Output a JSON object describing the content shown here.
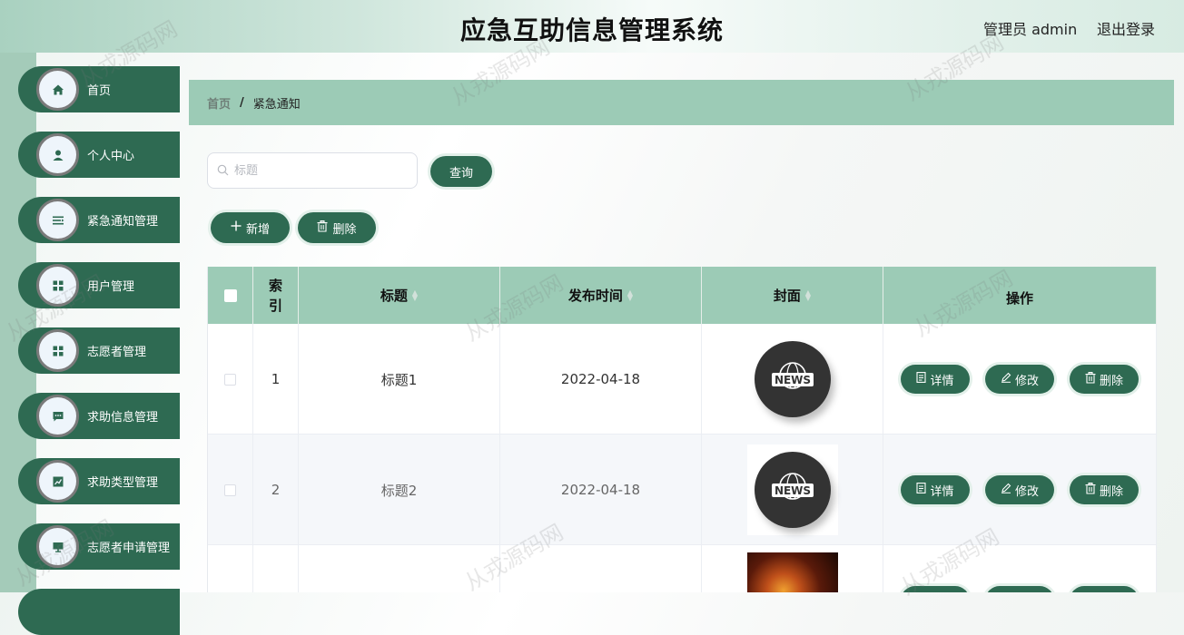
{
  "header": {
    "title": "应急互助信息管理系统",
    "admin_label": "管理员 admin",
    "logout_label": "退出登录"
  },
  "sidebar": {
    "items": [
      {
        "label": "首页",
        "icon": "home-icon"
      },
      {
        "label": "个人中心",
        "icon": "user-icon"
      },
      {
        "label": "紧急通知管理",
        "icon": "list-icon"
      },
      {
        "label": "用户管理",
        "icon": "grid-icon"
      },
      {
        "label": "志愿者管理",
        "icon": "grid-icon"
      },
      {
        "label": "求助信息管理",
        "icon": "chat-icon"
      },
      {
        "label": "求助类型管理",
        "icon": "chart-icon"
      },
      {
        "label": "志愿者申请管理",
        "icon": "monitor-icon"
      }
    ]
  },
  "breadcrumb": {
    "home": "首页",
    "separator": "/",
    "current": "紧急通知"
  },
  "search": {
    "placeholder": "标题",
    "value": "",
    "query_label": "查询"
  },
  "toolbar": {
    "add_label": "新增",
    "delete_label": "删除"
  },
  "table": {
    "columns": {
      "index": "索引",
      "title": "标题",
      "publish_time": "发布时间",
      "cover": "封面",
      "actions": "操作"
    },
    "rows": [
      {
        "index": "1",
        "title": "标题1",
        "publish_time": "2022-04-18",
        "cover": "news-icon"
      },
      {
        "index": "2",
        "title": "标题2",
        "publish_time": "2022-04-18",
        "cover": "news-icon"
      },
      {
        "index": "",
        "title": "",
        "publish_time": "",
        "cover": "fire-image"
      }
    ],
    "row_actions": {
      "detail": "详情",
      "edit": "修改",
      "delete": "删除"
    },
    "news_text": "NEWS"
  },
  "watermark": "从戎源码网",
  "colors": {
    "primary": "#2e6a52",
    "header_bg": "#9ccbb6",
    "sidebar_strip": "#a4cbb9"
  }
}
